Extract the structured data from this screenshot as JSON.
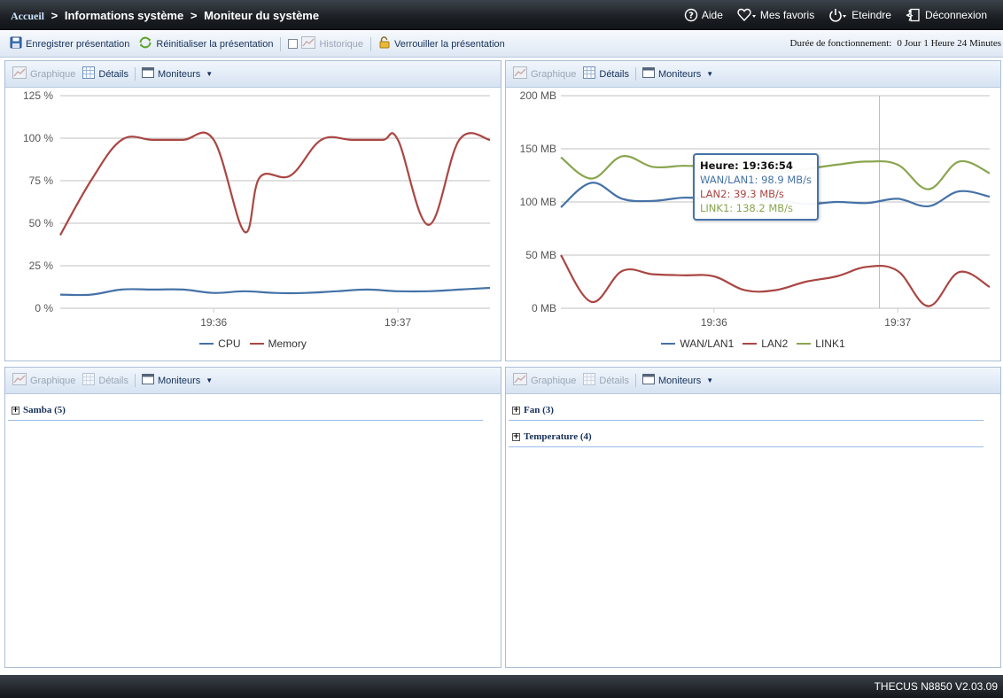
{
  "breadcrumb": {
    "home": "Accueil",
    "sep": ">",
    "section": "Informations système",
    "page": "Moniteur du système"
  },
  "topnav": {
    "help": "Aide",
    "favorites": "Mes favoris",
    "shutdown": "Eteindre",
    "logout": "Déconnexion"
  },
  "toolbar": {
    "save": "Enregistrer présentation",
    "reset": "Réinitialiser la présentation",
    "history": "Historique",
    "lock": "Verrouiller la présentation",
    "uptime_label": "Durée de fonctionnement:",
    "uptime_value": "0 Jour 1 Heure 24 Minutes"
  },
  "panel_head": {
    "graph": "Graphique",
    "details": "Détails",
    "monitors": "Moniteurs"
  },
  "panels": {
    "cpu_memory": {
      "legend": [
        "CPU",
        "Memory"
      ]
    },
    "network": {
      "legend": [
        "WAN/LAN1",
        "LAN2",
        "LINK1"
      ],
      "tooltip": {
        "title": "Heure: 19:36:54",
        "lines": [
          "WAN/LAN1: 98.9 MB/s",
          "LAN2: 39.3 MB/s",
          "LINK1: 138.2 MB/s"
        ]
      }
    },
    "samba": {
      "group": "Samba (5)"
    },
    "hardware": {
      "groups": [
        "Fan (3)",
        "Temperature (4)"
      ]
    }
  },
  "colors": {
    "series_blue": "#4572a7",
    "series_red": "#aa4643",
    "series_green": "#89a54e"
  },
  "chart_data": [
    {
      "type": "line",
      "x_ticks": [
        "19:36",
        "19:37"
      ],
      "y_ticks": [
        "0 %",
        "25 %",
        "50 %",
        "75 %",
        "100 %",
        "125 %"
      ],
      "ylim": [
        0,
        125
      ],
      "xlim": [
        "19:35:10",
        "19:37:30"
      ],
      "series": [
        {
          "name": "CPU",
          "points": [
            [
              "19:35:10",
              8
            ],
            [
              "19:35:20",
              8
            ],
            [
              "19:35:30",
              11
            ],
            [
              "19:35:40",
              11
            ],
            [
              "19:35:50",
              11
            ],
            [
              "19:36:00",
              9
            ],
            [
              "19:36:10",
              10
            ],
            [
              "19:36:20",
              9
            ],
            [
              "19:36:30",
              9
            ],
            [
              "19:36:40",
              10
            ],
            [
              "19:36:50",
              11
            ],
            [
              "19:37:00",
              10
            ],
            [
              "19:37:10",
              10
            ],
            [
              "19:37:20",
              11
            ],
            [
              "19:37:30",
              12
            ]
          ]
        },
        {
          "name": "Memory",
          "points": [
            [
              "19:35:10",
              43
            ],
            [
              "19:35:20",
              75
            ],
            [
              "19:35:30",
              99
            ],
            [
              "19:35:40",
              99
            ],
            [
              "19:35:50",
              99
            ],
            [
              "19:36:00",
              99
            ],
            [
              "19:36:10",
              45
            ],
            [
              "19:36:15",
              77
            ],
            [
              "19:36:25",
              78
            ],
            [
              "19:36:35",
              99
            ],
            [
              "19:36:45",
              99
            ],
            [
              "19:36:55",
              99
            ],
            [
              "19:37:00",
              99
            ],
            [
              "19:37:10",
              49
            ],
            [
              "19:37:20",
              99
            ],
            [
              "19:37:30",
              99
            ]
          ]
        }
      ]
    },
    {
      "type": "line",
      "x_ticks": [
        "19:36",
        "19:37"
      ],
      "y_ticks": [
        "0 MB",
        "50 MB",
        "100 MB",
        "150 MB",
        "200 MB"
      ],
      "ylim": [
        0,
        200
      ],
      "xlim": [
        "19:35:10",
        "19:37:30"
      ],
      "series": [
        {
          "name": "WAN/LAN1",
          "points": [
            [
              "19:35:10",
              95
            ],
            [
              "19:35:20",
              118
            ],
            [
              "19:35:30",
              103
            ],
            [
              "19:35:40",
              101
            ],
            [
              "19:35:50",
              104
            ],
            [
              "19:36:00",
              103
            ],
            [
              "19:36:10",
              103
            ],
            [
              "19:36:20",
              102
            ],
            [
              "19:36:30",
              98
            ],
            [
              "19:36:40",
              100
            ],
            [
              "19:36:50",
              99
            ],
            [
              "19:37:00",
              103
            ],
            [
              "19:37:10",
              96
            ],
            [
              "19:37:20",
              110
            ],
            [
              "19:37:30",
              105
            ]
          ]
        },
        {
          "name": "LAN2",
          "points": [
            [
              "19:35:10",
              50
            ],
            [
              "19:35:20",
              6
            ],
            [
              "19:35:30",
              35
            ],
            [
              "19:35:40",
              32
            ],
            [
              "19:35:50",
              31
            ],
            [
              "19:36:00",
              30
            ],
            [
              "19:36:10",
              17
            ],
            [
              "19:36:20",
              17
            ],
            [
              "19:36:30",
              25
            ],
            [
              "19:36:40",
              30
            ],
            [
              "19:36:50",
              39
            ],
            [
              "19:37:00",
              35
            ],
            [
              "19:37:10",
              2
            ],
            [
              "19:37:20",
              34
            ],
            [
              "19:37:30",
              20
            ]
          ]
        },
        {
          "name": "LINK1",
          "points": [
            [
              "19:35:10",
              142
            ],
            [
              "19:35:20",
              122
            ],
            [
              "19:35:30",
              143
            ],
            [
              "19:35:40",
              133
            ],
            [
              "19:35:50",
              134
            ],
            [
              "19:36:00",
              133
            ],
            [
              "19:36:10",
              130
            ],
            [
              "19:36:20",
              128
            ],
            [
              "19:36:30",
              131
            ],
            [
              "19:36:40",
              135
            ],
            [
              "19:36:50",
              138
            ],
            [
              "19:37:00",
              135
            ],
            [
              "19:37:10",
              112
            ],
            [
              "19:37:20",
              138
            ],
            [
              "19:37:30",
              127
            ]
          ]
        }
      ]
    }
  ]
}
